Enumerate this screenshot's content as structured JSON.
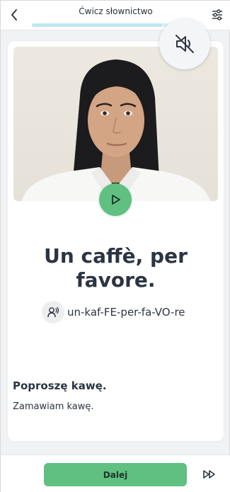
{
  "header": {
    "title": "Ćwicz słownictwo",
    "back_icon": "chevron-left-icon",
    "settings_icon": "sliders-icon",
    "progress_fraction": 0.78
  },
  "audio": {
    "mute_icon": "speaker-muted-icon"
  },
  "card": {
    "play_icon": "play-icon",
    "phrase": "Un caffè, per favore.",
    "pronunciation_icon": "pronunciation-speaker-icon",
    "pronunciation": "un-kaf-FE-per-fa-VO-re",
    "translation": "Poproszę kawę.",
    "alt_translation": "Zamawiam kawę."
  },
  "footer": {
    "next_label": "Dalej",
    "skip_icon": "fast-forward-icon"
  },
  "colors": {
    "accent_green": "#5fc082",
    "progress_blue": "#bfe6f4",
    "text_dark": "#2c3442"
  }
}
